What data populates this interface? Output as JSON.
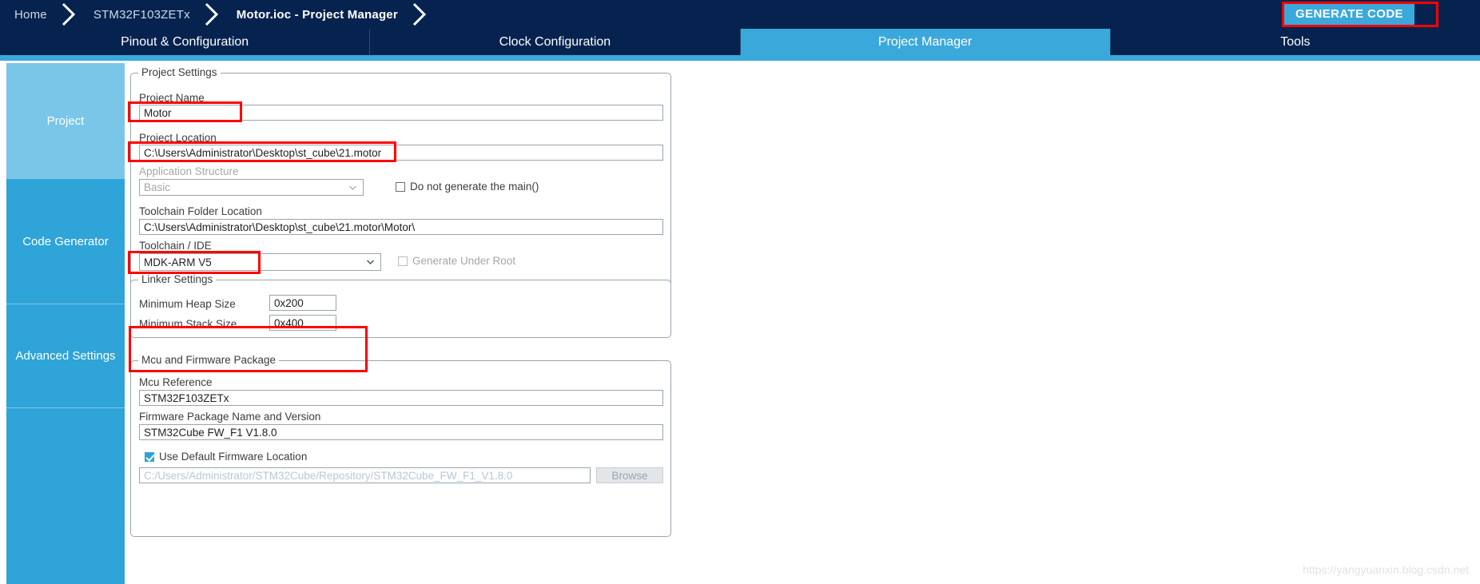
{
  "breadcrumb": {
    "items": [
      {
        "label": "Home",
        "active": false
      },
      {
        "label": "STM32F103ZETx",
        "active": false
      },
      {
        "label": "Motor.ioc - Project Manager",
        "active": true
      }
    ]
  },
  "toolbar": {
    "generate_code_label": "GENERATE CODE"
  },
  "tabs": [
    {
      "label": "Pinout & Configuration",
      "active": false
    },
    {
      "label": "Clock Configuration",
      "active": false
    },
    {
      "label": "Project Manager",
      "active": true
    },
    {
      "label": "Tools",
      "active": false
    }
  ],
  "sidebar": {
    "items": [
      {
        "label": "Project",
        "active": true
      },
      {
        "label": "Code Generator",
        "active": false
      },
      {
        "label": "Advanced Settings",
        "active": false
      },
      {
        "label": "",
        "active": false
      }
    ]
  },
  "project_settings": {
    "group_title": "Project Settings",
    "project_name_label": "Project Name",
    "project_name_value": "Motor",
    "project_location_label": "Project Location",
    "project_location_value": "C:\\Users\\Administrator\\Desktop\\st_cube\\21.motor",
    "application_structure_label": "Application Structure",
    "application_structure_value": "Basic",
    "do_not_generate_main_label": "Do not generate the main()",
    "do_not_generate_main_checked": false,
    "toolchain_folder_label": "Toolchain Folder Location",
    "toolchain_folder_value": "C:\\Users\\Administrator\\Desktop\\st_cube\\21.motor\\Motor\\",
    "toolchain_ide_label": "Toolchain / IDE",
    "toolchain_ide_value": "MDK-ARM V5",
    "generate_under_root_label": "Generate Under Root",
    "generate_under_root_checked": false
  },
  "linker_settings": {
    "group_title": "Linker Settings",
    "min_heap_label": "Minimum Heap Size",
    "min_heap_value": "0x200",
    "min_stack_label": "Minimum Stack Size",
    "min_stack_value": "0x400"
  },
  "mcu_firmware": {
    "group_title": "Mcu and Firmware Package",
    "mcu_reference_label": "Mcu Reference",
    "mcu_reference_value": "STM32F103ZETx",
    "firmware_package_label": "Firmware Package Name and Version",
    "firmware_package_value": "STM32Cube FW_F1 V1.8.0",
    "use_default_firmware_label": "Use Default Firmware Location",
    "use_default_firmware_checked": true,
    "firmware_path_value": "C:/Users/Administrator/STM32Cube/Repository/STM32Cube_FW_F1_V1.8.0",
    "browse_label": "Browse"
  },
  "watermark": "https://yangyuanxin.blog.csdn.net",
  "colors": {
    "dark_navy": "#06234f",
    "accent_blue": "#3ba8dc",
    "sidebar_active": "#79c6e9",
    "sidebar_idle": "#2ea4d8",
    "annotation_red": "#ff0000"
  }
}
